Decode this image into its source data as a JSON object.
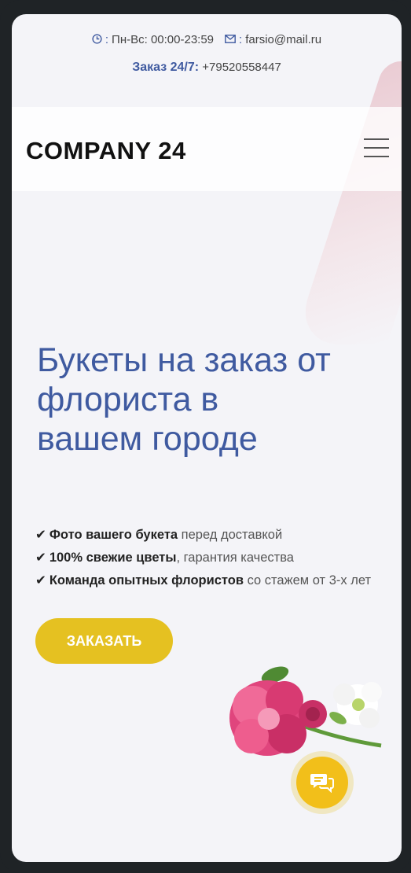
{
  "topbar": {
    "hours_label": "Пн-Вс: 00:00-23:59",
    "email": "farsio@mail.ru",
    "order_label": "Заказ 24/7:",
    "phone": "+79520558447"
  },
  "header": {
    "logo": "COMPANY 24"
  },
  "hero": {
    "title_line1": "Букеты на заказ от",
    "title_line2": "флориста в",
    "title_line3": "вашем городе"
  },
  "features": [
    {
      "bold": "Фото вашего букета",
      "rest": " перед доставкой"
    },
    {
      "bold": "100% свежие цветы",
      "rest": ", гарантия качества"
    },
    {
      "bold": "Команда опытных флористов",
      "rest": " со стажем от 3-х лет"
    }
  ],
  "cta": {
    "order_button": "ЗАКАЗАТЬ"
  },
  "colors": {
    "accent": "#3f5aa0",
    "button": "#e5c121",
    "background": "#f4f4f8"
  },
  "icons": [
    "clock-icon",
    "mail-icon",
    "menu-icon",
    "chat-icon",
    "check-icon"
  ]
}
